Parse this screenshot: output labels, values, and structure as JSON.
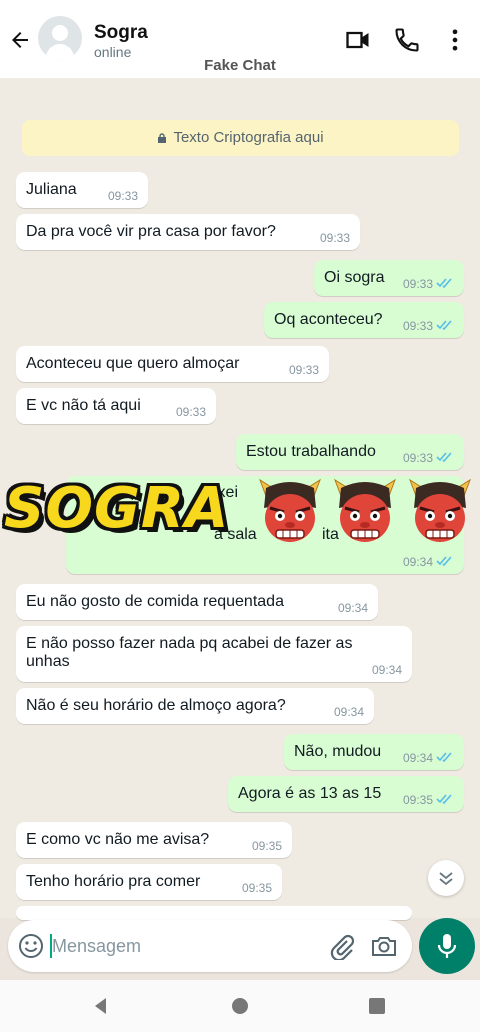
{
  "header": {
    "contact_name": "Sogra",
    "status": "online",
    "watermark": "Fake Chat",
    "icons": [
      "back-arrow-icon",
      "avatar",
      "video-call-icon",
      "phone-icon",
      "more-vert-icon"
    ]
  },
  "encryption_notice": "Texto Criptografia aqui",
  "overlay": {
    "title": "SOGRA",
    "emoji": [
      "ogre-icon",
      "ogre-icon",
      "ogre-icon"
    ],
    "partial_text_1": "ixei",
    "partial_text_2": "a sala",
    "partial_text_3": "ita"
  },
  "messages": [
    {
      "dir": "in",
      "text": "Juliana",
      "time": "09:33"
    },
    {
      "dir": "in",
      "text": "Da pra você vir pra casa por favor?",
      "time": "09:33"
    },
    {
      "dir": "out",
      "text": "Oi sogra",
      "time": "09:33",
      "read": true
    },
    {
      "dir": "out",
      "text": "Oq aconteceu?",
      "time": "09:33",
      "read": true
    },
    {
      "dir": "in",
      "text": "Aconteceu que quero almoçar",
      "time": "09:33"
    },
    {
      "dir": "in",
      "text": "E vc não tá aqui",
      "time": "09:33"
    },
    {
      "dir": "out",
      "text": "Estou trabalhando",
      "time": "09:33",
      "read": true
    },
    {
      "dir": "out",
      "text": "",
      "time": "09:34",
      "read": true
    },
    {
      "dir": "in",
      "text": "Eu não gosto de comida requentada",
      "time": "09:34"
    },
    {
      "dir": "in",
      "text": "E não posso fazer nada pq acabei de fazer as unhas",
      "time": "09:34"
    },
    {
      "dir": "in",
      "text": "Não é seu horário de almoço agora?",
      "time": "09:34"
    },
    {
      "dir": "out",
      "text": "Não, mudou",
      "time": "09:34",
      "read": true
    },
    {
      "dir": "out",
      "text": "Agora é as 13 as 15",
      "time": "09:35",
      "read": true
    },
    {
      "dir": "in",
      "text": "E como vc não me avisa?",
      "time": "09:35"
    },
    {
      "dir": "in",
      "text": "Tenho horário pra comer",
      "time": "09:35"
    }
  ],
  "input": {
    "placeholder": "Mensagem"
  },
  "colors": {
    "accent": "#008069",
    "outgoing_bubble": "#d9fdd3",
    "read_ticks": "#53bdeb",
    "overlay_text": "#f7d81d"
  }
}
